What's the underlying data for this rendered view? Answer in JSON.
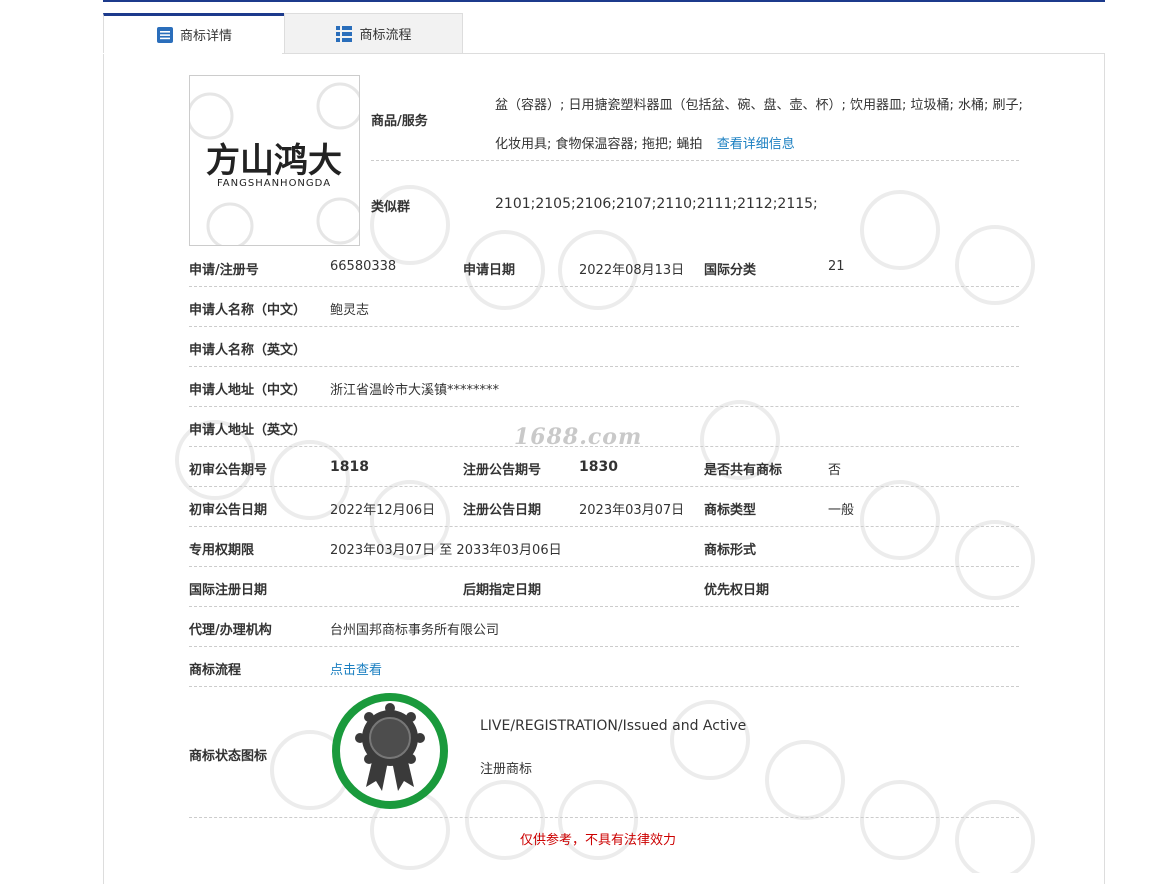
{
  "tabs": [
    {
      "label": "商标详情",
      "icon": "list-doc-icon"
    },
    {
      "label": "商标流程",
      "icon": "grid-list-icon"
    }
  ],
  "logo": {
    "text_cn": "方山鸿大",
    "text_en": "FANGSHANHONGDA"
  },
  "goods": {
    "label": "商品/服务",
    "value": "盆（容器）; 日用搪瓷塑料器皿（包括盆、碗、盘、壶、杯）; 饮用器皿; 垃圾桶; 水桶; 刷子; 化妆用具; 食物保温容器; 拖把; 蝇拍",
    "link": "查看详细信息"
  },
  "similar_group": {
    "label": "类似群",
    "value": "2101;2105;2106;2107;2110;2111;2112;2115;"
  },
  "fields": {
    "app_no_label": "申请/注册号",
    "app_no": "66580338",
    "app_date_label": "申请日期",
    "app_date": "2022年08月13日",
    "intl_class_label": "国际分类",
    "intl_class": "21",
    "applicant_cn_label": "申请人名称（中文）",
    "applicant_cn": "鲍灵志",
    "applicant_en_label": "申请人名称（英文）",
    "address_cn_label": "申请人地址（中文）",
    "address_cn": "浙江省温岭市大溪镇********",
    "address_en_label": "申请人地址（英文）",
    "prelim_no_label": "初审公告期号",
    "prelim_no": "1818",
    "reg_no_label": "注册公告期号",
    "reg_no": "1830",
    "shared_label": "是否共有商标",
    "shared": "否",
    "prelim_date_label": "初审公告日期",
    "prelim_date": "2022年12月06日",
    "reg_date_label": "注册公告日期",
    "reg_date": "2023年03月07日",
    "tm_type_label": "商标类型",
    "tm_type": "一般",
    "term_label": "专用权期限",
    "term": "2023年03月07日 至 2033年03月06日",
    "tm_form_label": "商标形式",
    "intl_reg_date_label": "国际注册日期",
    "later_date_label": "后期指定日期",
    "priority_date_label": "优先权日期",
    "agent_label": "代理/办理机构",
    "agent": "台州国邦商标事务所有限公司",
    "flow_label": "商标流程",
    "flow_link": "点击查看",
    "status_icon_label": "商标状态图标"
  },
  "status": {
    "en": "LIVE/REGISTRATION/Issued and Active",
    "cn": "注册商标",
    "ring_color": "#1a9a3c"
  },
  "watermark": "1688.com",
  "disclaimer": "仅供参考，不具有法律效力",
  "colors": {
    "accent": "#1c3a8c",
    "link": "#1a7fc1",
    "warning": "#cc0000"
  }
}
